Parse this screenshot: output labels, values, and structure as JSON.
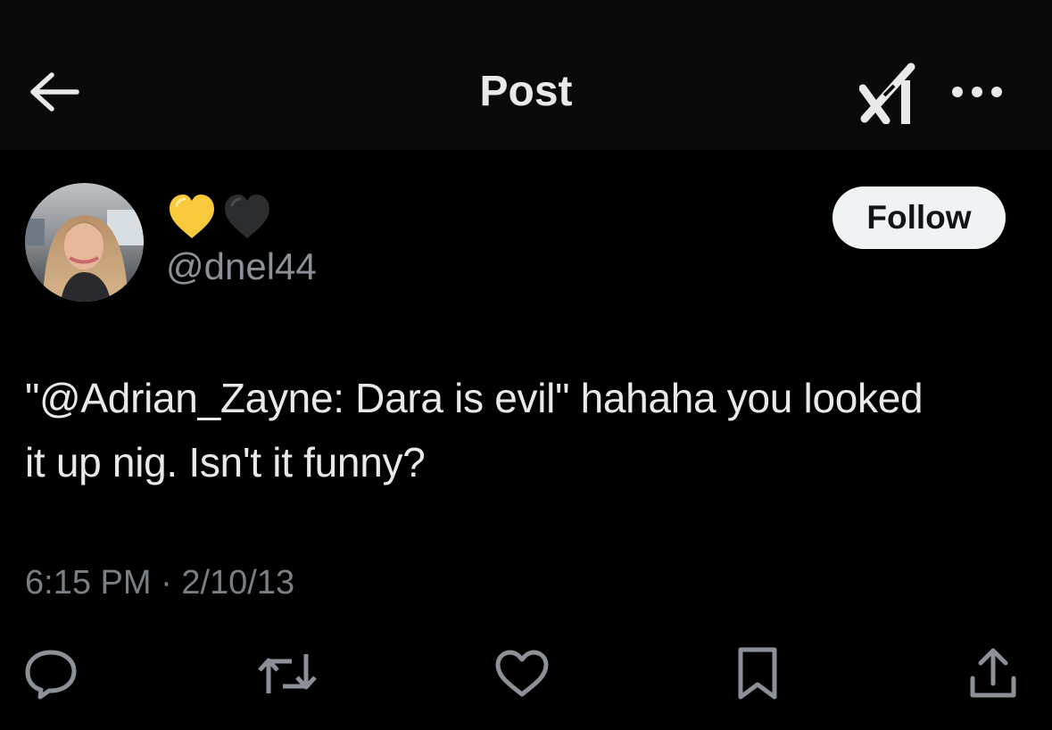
{
  "header": {
    "title": "Post",
    "back_icon": "arrow-left-icon",
    "grok_icon": "grok-logo-icon",
    "more_icon": "more-horizontal-icon"
  },
  "author": {
    "display_name_icons": [
      "yellow-heart-icon",
      "black-heart-icon"
    ],
    "handle": "@dnel44",
    "follow_label": "Follow"
  },
  "post": {
    "text_line_1": "\"@Adrian_Zayne: Dara is evil\" hahaha you looked",
    "text_line_2": "it up nig. Isn't it funny?",
    "time": "6:15 PM",
    "separator": "·",
    "date": "2/10/13"
  },
  "actions": [
    {
      "icon": "reply-icon"
    },
    {
      "icon": "repost-icon"
    },
    {
      "icon": "like-icon"
    },
    {
      "icon": "bookmark-icon"
    },
    {
      "icon": "share-icon"
    }
  ],
  "colors": {
    "background": "#000000",
    "header_background": "#0a0a0a",
    "text_primary": "#e7e9ea",
    "text_secondary": "#8b9197",
    "follow_button_bg": "#eff3f4",
    "heart_yellow": "#f8c93a"
  }
}
